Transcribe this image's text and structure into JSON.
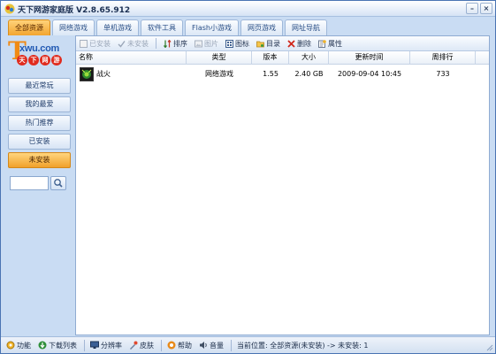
{
  "window": {
    "title": "天下网游家庭版 V2.8.65.912"
  },
  "tabs": [
    {
      "label": "全部资源",
      "active": true
    },
    {
      "label": "网络游戏"
    },
    {
      "label": "单机游戏"
    },
    {
      "label": "软件工具"
    },
    {
      "label": "Flash小游戏"
    },
    {
      "label": "网页游戏"
    },
    {
      "label": "网址导航"
    }
  ],
  "logo": {
    "letter": "T",
    "url": "xwu.com",
    "chars": [
      "天",
      "下",
      "网",
      "游"
    ]
  },
  "sidebar": {
    "items": [
      {
        "label": "最近常玩"
      },
      {
        "label": "我的最爱"
      },
      {
        "label": "热门推荐"
      },
      {
        "label": "已安装"
      },
      {
        "label": "未安装",
        "active": true
      }
    ],
    "search": {
      "value": ""
    }
  },
  "toolbar": {
    "installed": "已安装",
    "not_installed": "未安装",
    "sort": "排序",
    "picture": "图片",
    "icon": "图标",
    "directory": "目录",
    "delete": "删除",
    "properties": "属性"
  },
  "table": {
    "columns": [
      "名称",
      "类型",
      "版本",
      "大小",
      "更新时间",
      "周排行"
    ],
    "rows": [
      {
        "name": "战火",
        "type": "网络游戏",
        "version": "1.55",
        "size": "2.40 GB",
        "updated": "2009-09-04 10:45",
        "rank": "733"
      }
    ]
  },
  "statusbar": {
    "function": "功能",
    "download_list": "下载列表",
    "resolution": "分辨率",
    "skin": "皮肤",
    "help": "帮助",
    "volume": "音量",
    "location": "当前位置: 全部资源(未安装) -> 未安装: 1"
  },
  "colors": {
    "accent": "#f2a531",
    "frame": "#4a74b3",
    "background": "#c9dcf3"
  }
}
